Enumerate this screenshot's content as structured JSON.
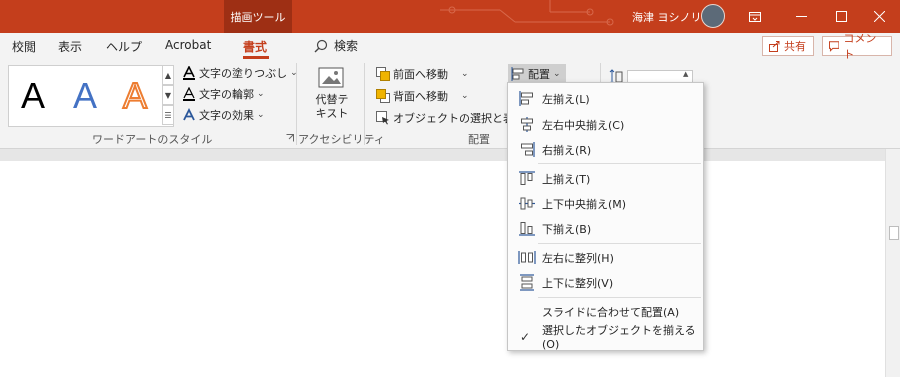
{
  "titlebar": {
    "context_tab": "描画ツール",
    "user_name": "海津 ヨシノリ"
  },
  "tabs": [
    {
      "label": "校閲"
    },
    {
      "label": "表示"
    },
    {
      "label": "ヘルプ"
    },
    {
      "label": "Acrobat"
    },
    {
      "label": "書式"
    }
  ],
  "search": {
    "label": "検索"
  },
  "actions": {
    "share": "共有",
    "comment": "コメント"
  },
  "ribbon": {
    "wordart_letter": "A",
    "text_fill": "文字の塗りつぶし",
    "text_outline": "文字の輪郭",
    "text_effects": "文字の効果",
    "alt_text_line1": "代替テ",
    "alt_text_line2": "キスト",
    "bring_forward": "前面へ移動",
    "send_backward": "背面へ移動",
    "selection_pane": "オブジェクトの選択と表示",
    "arrange": "配置",
    "group_wordart": "ワードアートのスタイル",
    "group_accessibility": "アクセシビリティ",
    "group_arrange": "配置"
  },
  "menu": {
    "items": [
      {
        "label": "左揃え(L)"
      },
      {
        "label": "左右中央揃え(C)"
      },
      {
        "label": "右揃え(R)"
      },
      {
        "label": "上揃え(T)"
      },
      {
        "label": "上下中央揃え(M)"
      },
      {
        "label": "下揃え(B)"
      },
      {
        "label": "左右に整列(H)"
      },
      {
        "label": "上下に整列(V)"
      },
      {
        "label": "スライドに合わせて配置(A)"
      },
      {
        "label": "選択したオブジェクトを揃える(O)"
      }
    ]
  },
  "colors": {
    "accent": "#c43e1c",
    "accent_dark": "#9e2f14",
    "ribbon_bg": "#f3f3f3",
    "icon_blue": "#2b579a"
  }
}
